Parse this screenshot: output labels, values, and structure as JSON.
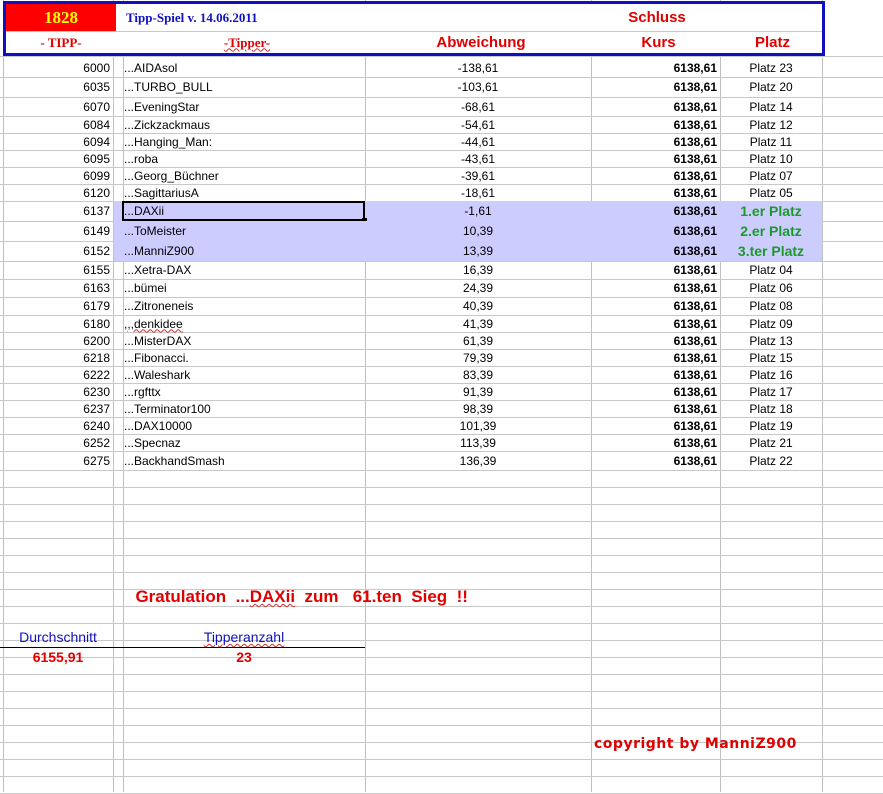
{
  "header": {
    "count": "1828",
    "title": "Tipp-Spiel v. 14.06.2011",
    "schluss": "Schluss",
    "col_tipp": "- TIPP-",
    "col_tipper": "-Tipper-",
    "col_abweichung": "Abweichung",
    "col_kurs": "Kurs",
    "col_platz": "Platz"
  },
  "rows": [
    {
      "tipp": "6000",
      "name": "...AIDAsol",
      "abw": "-138,61",
      "kurs": "6138,61",
      "platz": "Platz 23"
    },
    {
      "tipp": "6035",
      "name": "...TURBO_BULL",
      "abw": "-103,61",
      "kurs": "6138,61",
      "platz": "Platz 20"
    },
    {
      "tipp": "6070",
      "name": "...EveningStar",
      "abw": "-68,61",
      "kurs": "6138,61",
      "platz": "Platz 14"
    },
    {
      "tipp": "6084",
      "name": "...Zickzackmaus",
      "abw": "-54,61",
      "kurs": "6138,61",
      "platz": "Platz 12"
    },
    {
      "tipp": "6094",
      "name": "...Hanging_Man:",
      "abw": "-44,61",
      "kurs": "6138,61",
      "platz": "Platz 11"
    },
    {
      "tipp": "6095",
      "name": "...roba",
      "abw": "-43,61",
      "kurs": "6138,61",
      "platz": "Platz 10"
    },
    {
      "tipp": "6099",
      "name": "...Georg_Büchner",
      "abw": "-39,61",
      "kurs": "6138,61",
      "platz": "Platz 07"
    },
    {
      "tipp": "6120",
      "name": "...SagittariusA",
      "abw": "-18,61",
      "kurs": "6138,61",
      "platz": "Platz 05"
    },
    {
      "tipp": "6137",
      "name": "...DAXii",
      "abw": "-1,61",
      "kurs": "6138,61",
      "platz": "1.er Platz",
      "winner": true,
      "selected": true
    },
    {
      "tipp": "6149",
      "name": "...ToMeister",
      "abw": "10,39",
      "kurs": "6138,61",
      "platz": "2.er Platz",
      "winner": true
    },
    {
      "tipp": "6152",
      "name": "...ManniZ900",
      "abw": "13,39",
      "kurs": "6138,61",
      "platz": "3.ter Platz",
      "winner": true
    },
    {
      "tipp": "6155",
      "name": "...Xetra-DAX",
      "abw": "16,39",
      "kurs": "6138,61",
      "platz": "Platz 04"
    },
    {
      "tipp": "6163",
      "name": "...bümei",
      "abw": "24,39",
      "kurs": "6138,61",
      "platz": "Platz 06"
    },
    {
      "tipp": "6179",
      "name": "...Zitroneneis",
      "abw": "40,39",
      "kurs": "6138,61",
      "platz": "Platz 08"
    },
    {
      "tipp": "6180",
      "name": ",,,denkidee",
      "abw": "41,39",
      "kurs": "6138,61",
      "platz": "Platz 09"
    },
    {
      "tipp": "6200",
      "name": "...MisterDAX",
      "abw": "61,39",
      "kurs": "6138,61",
      "platz": "Platz 13"
    },
    {
      "tipp": "6218",
      "name": "...Fibonacci.",
      "abw": "79,39",
      "kurs": "6138,61",
      "platz": "Platz 15"
    },
    {
      "tipp": "6222",
      "name": "...Waleshark",
      "abw": "83,39",
      "kurs": "6138,61",
      "platz": "Platz 16"
    },
    {
      "tipp": "6230",
      "name": "...rgfttx",
      "abw": "91,39",
      "kurs": "6138,61",
      "platz": "Platz 17"
    },
    {
      "tipp": "6237",
      "name": "...Terminator100",
      "abw": "98,39",
      "kurs": "6138,61",
      "platz": "Platz 18"
    },
    {
      "tipp": "6240",
      "name": "...DAX10000",
      "abw": "101,39",
      "kurs": "6138,61",
      "platz": "Platz 19"
    },
    {
      "tipp": "6252",
      "name": "...Specnaz",
      "abw": "113,39",
      "kurs": "6138,61",
      "platz": "Platz 21"
    },
    {
      "tipp": "6275",
      "name": "...BackhandSmash",
      "abw": "136,39",
      "kurs": "6138,61",
      "platz": "Platz 22"
    }
  ],
  "gratulation": {
    "prefix": "Gratulation  ...",
    "name": "DAXii",
    "suffix": "  zum   61.ten  Sieg  !!"
  },
  "summary": {
    "avg_label": "Durchschnitt",
    "avg_value": "6155,91",
    "count_label": "Tipperanzahl",
    "count_value": "23"
  },
  "copyright": "copyright by ManniZ900",
  "colors": {
    "red": "#e00000",
    "blue": "#1010c0",
    "highlight": "#ccccff",
    "green": "#1a9a2a"
  }
}
